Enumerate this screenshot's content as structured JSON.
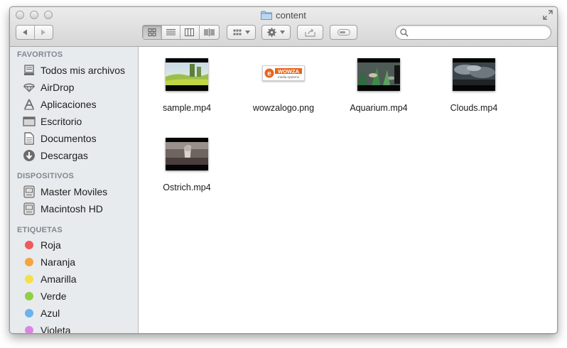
{
  "window": {
    "title": "content"
  },
  "sidebar": {
    "sections": [
      {
        "label": "FAVORITOS"
      },
      {
        "label": "DISPOSITIVOS"
      },
      {
        "label": "ETIQUETAS"
      }
    ],
    "favorites": [
      {
        "label": "Todos mis archivos",
        "icon": "all-files-icon"
      },
      {
        "label": "AirDrop",
        "icon": "airdrop-icon"
      },
      {
        "label": "Aplicaciones",
        "icon": "applications-icon"
      },
      {
        "label": "Escritorio",
        "icon": "desktop-icon"
      },
      {
        "label": "Documentos",
        "icon": "documents-icon"
      },
      {
        "label": "Descargas",
        "icon": "downloads-icon"
      }
    ],
    "devices": [
      {
        "label": "Master Moviles",
        "icon": "hard-drive-icon"
      },
      {
        "label": "Macintosh HD",
        "icon": "hard-drive-icon"
      }
    ],
    "tags": [
      {
        "label": "Roja",
        "color": "#ef5b5b"
      },
      {
        "label": "Naranja",
        "color": "#f6a53c"
      },
      {
        "label": "Amarilla",
        "color": "#f3e04a"
      },
      {
        "label": "Verde",
        "color": "#8fd044"
      },
      {
        "label": "Azul",
        "color": "#6cb2ec"
      },
      {
        "label": "Violeta",
        "color": "#dc84e3"
      }
    ]
  },
  "search": {
    "value": "",
    "placeholder": ""
  },
  "files": [
    {
      "name": "sample.mp4",
      "kind": "video"
    },
    {
      "name": "wowzalogo.png",
      "kind": "image",
      "logo_text": "WOWZA",
      "logo_subtext": "media systems",
      "logo_mark": "e"
    },
    {
      "name": "Aquarium.mp4",
      "kind": "video"
    },
    {
      "name": "Clouds.mp4",
      "kind": "video"
    },
    {
      "name": "Ostrich.mp4",
      "kind": "video"
    }
  ],
  "colors": {
    "sidebar_bg": "#e8ebee",
    "section_header": "#808891",
    "wowza_orange": "#e8641b"
  }
}
